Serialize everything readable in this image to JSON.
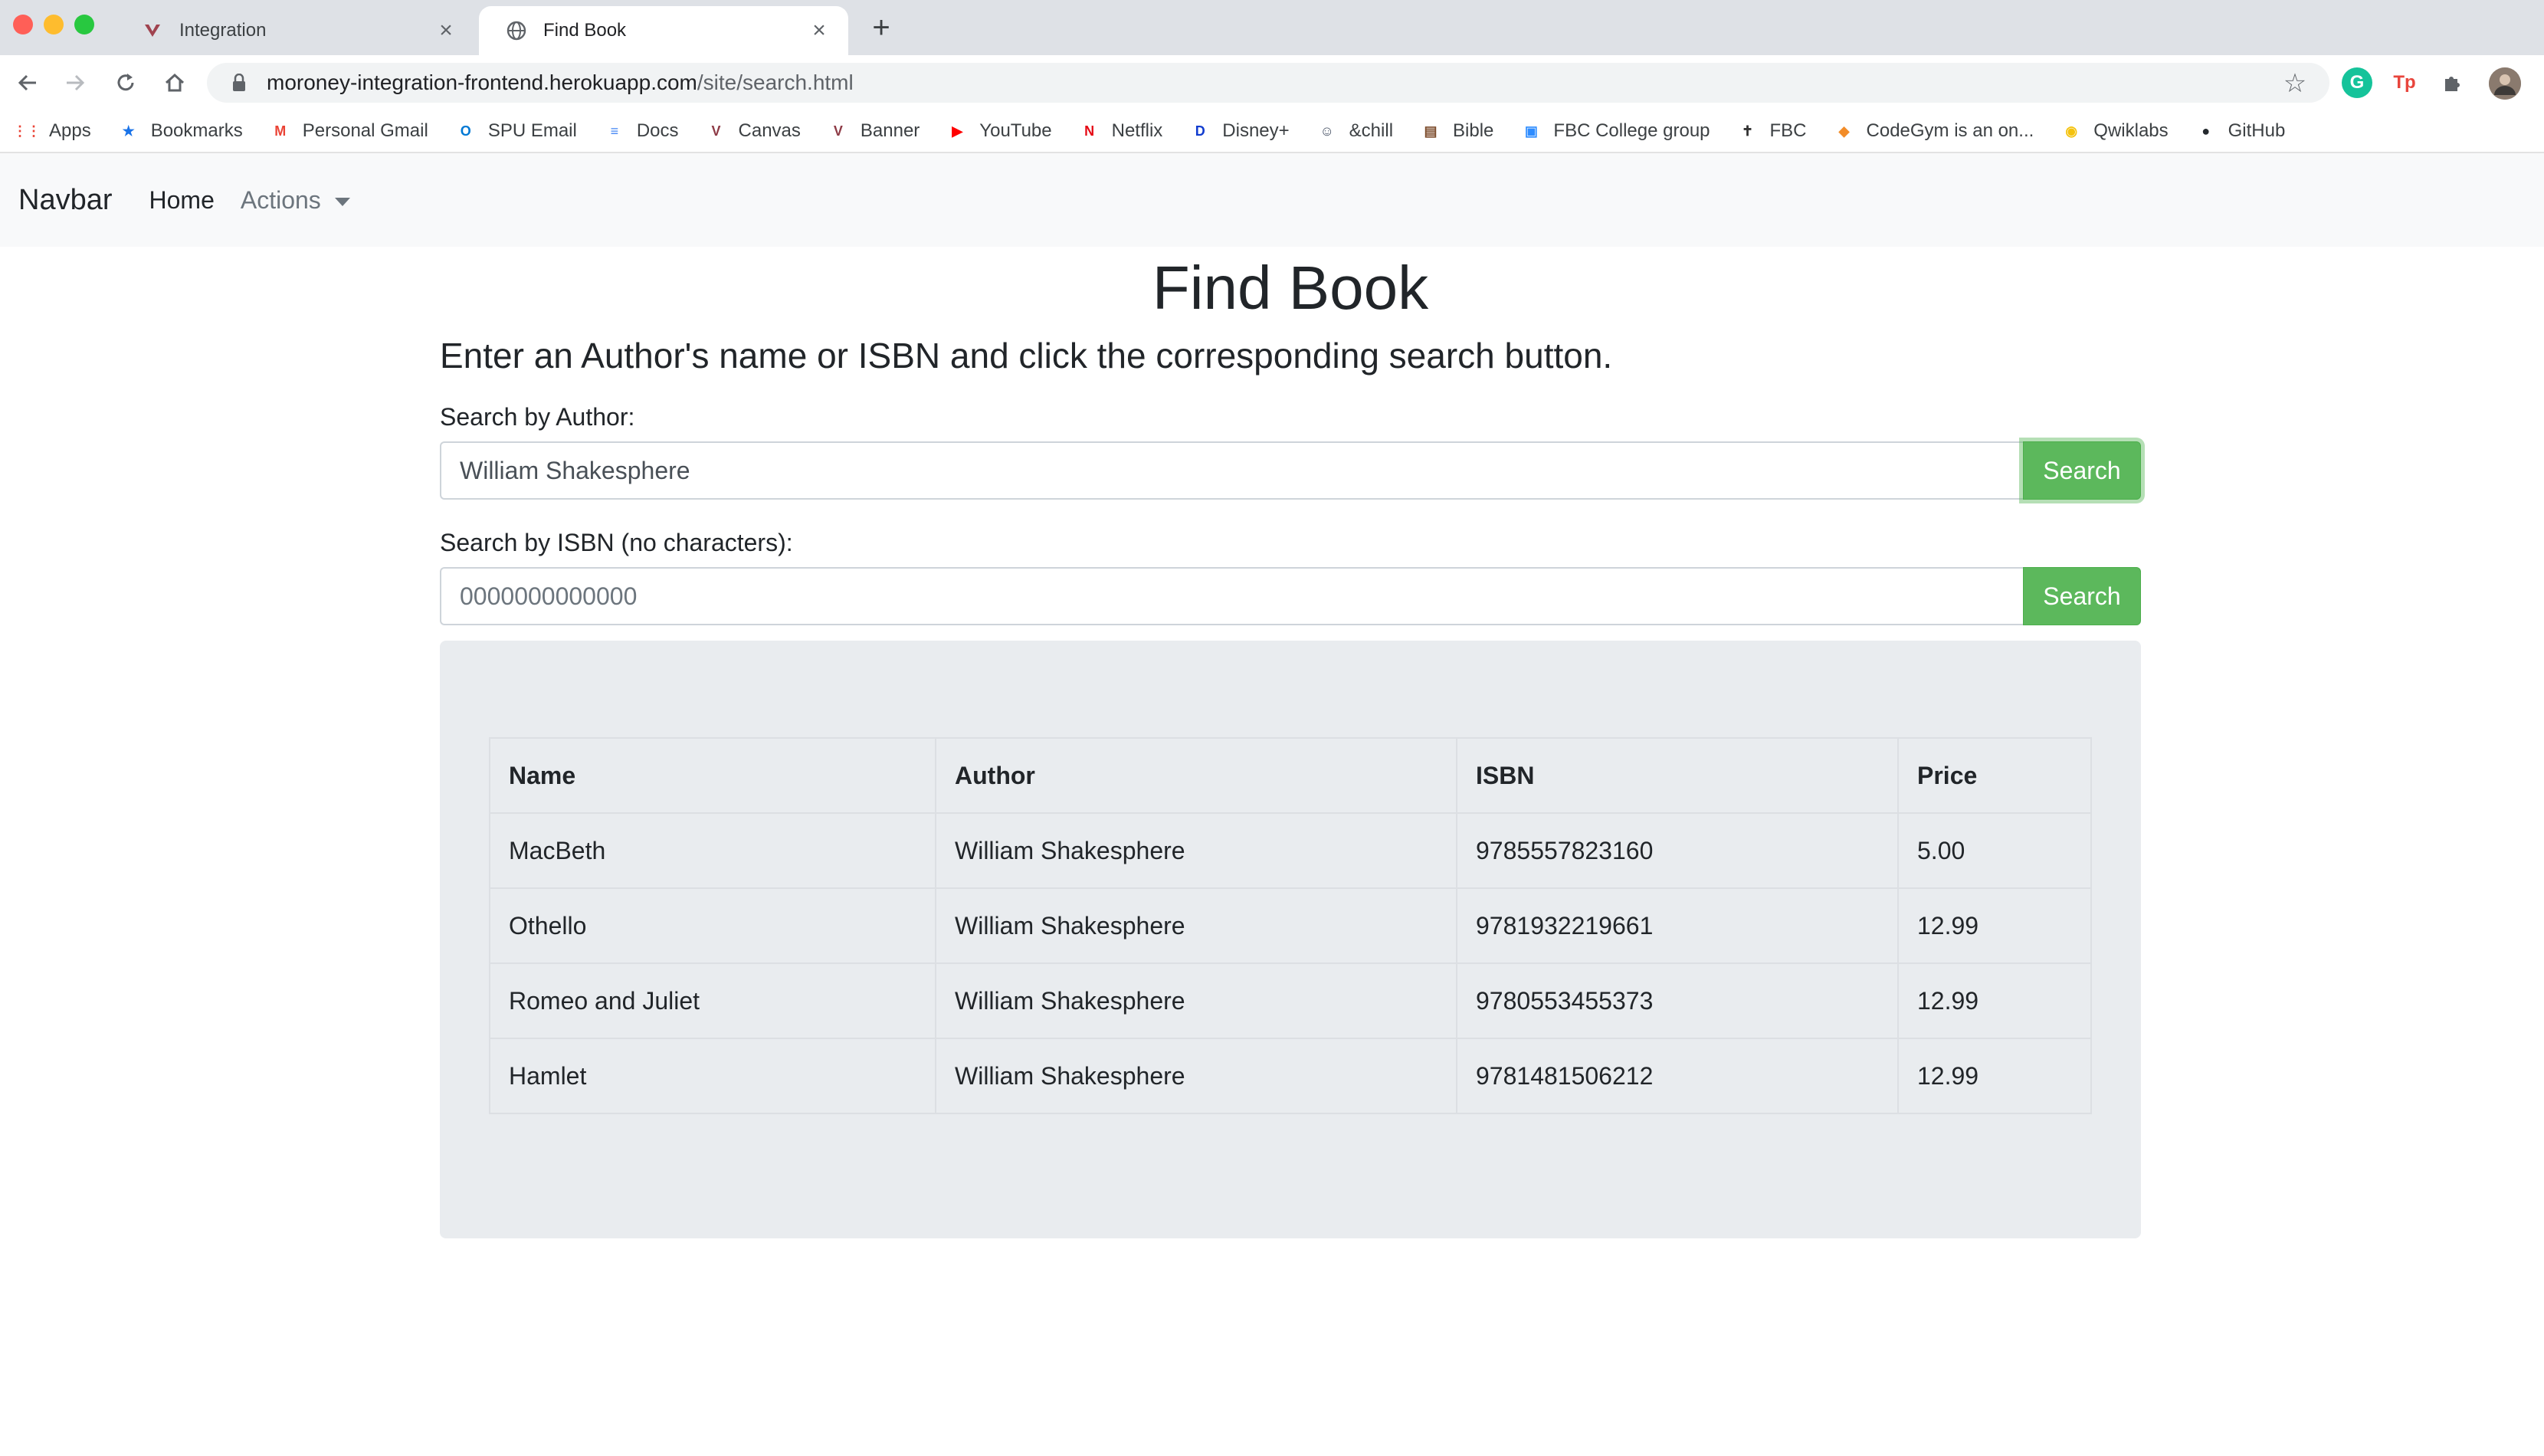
{
  "browser": {
    "tabs": [
      {
        "title": "Integration",
        "active": false,
        "icon": "canvas-logo-icon"
      },
      {
        "title": "Find Book",
        "active": true,
        "icon": "globe-icon"
      }
    ],
    "url_host": "moroney-integration-frontend.herokuapp.com",
    "url_path": "/site/search.html",
    "bookmarks": [
      {
        "label": "Apps",
        "icon": "apps-grid-icon",
        "color": "#ea4335"
      },
      {
        "label": "Bookmarks",
        "icon": "star-icon",
        "color": "#1a73e8"
      },
      {
        "label": "Personal Gmail",
        "icon": "gmail-icon",
        "color": "#ea4335"
      },
      {
        "label": "SPU Email",
        "icon": "outlook-icon",
        "color": "#0078d4"
      },
      {
        "label": "Docs",
        "icon": "docs-icon",
        "color": "#4285f4"
      },
      {
        "label": "Canvas",
        "icon": "canvas-icon",
        "color": "#8e3b46"
      },
      {
        "label": "Banner",
        "icon": "banner-icon",
        "color": "#8e3b46"
      },
      {
        "label": "YouTube",
        "icon": "youtube-icon",
        "color": "#ff0000"
      },
      {
        "label": "Netflix",
        "icon": "netflix-icon",
        "color": "#e50914"
      },
      {
        "label": "Disney+",
        "icon": "disney-icon",
        "color": "#113ccf"
      },
      {
        "label": "&chill",
        "icon": "chill-icon",
        "color": "#4a5568"
      },
      {
        "label": "Bible",
        "icon": "bible-icon",
        "color": "#7b4a2a"
      },
      {
        "label": "FBC College group",
        "icon": "zoom-icon",
        "color": "#2d8cff"
      },
      {
        "label": "FBC",
        "icon": "cross-icon",
        "color": "#333333"
      },
      {
        "label": "CodeGym is an on...",
        "icon": "codegym-icon",
        "color": "#f28c28"
      },
      {
        "label": "Qwiklabs",
        "icon": "qwiklabs-icon",
        "color": "#f4c20d"
      },
      {
        "label": "GitHub",
        "icon": "github-icon",
        "color": "#24292e"
      }
    ]
  },
  "navbar": {
    "brand": "Navbar",
    "home": "Home",
    "actions": "Actions"
  },
  "main": {
    "title": "Find Book",
    "subtitle": "Enter an Author's name or ISBN and click the corresponding search button.",
    "author_label": "Search by Author:",
    "author_value": "William Shakesphere",
    "isbn_label": "Search by ISBN (no characters):",
    "isbn_placeholder": "0000000000000",
    "search_button": "Search"
  },
  "results": {
    "headers": [
      "Name",
      "Author",
      "ISBN",
      "Price"
    ],
    "rows": [
      [
        "MacBeth",
        "William Shakesphere",
        "9785557823160",
        "5.00"
      ],
      [
        "Othello",
        "William Shakesphere",
        "9781932219661",
        "12.99"
      ],
      [
        "Romeo and Juliet",
        "William Shakesphere",
        "9780553455373",
        "12.99"
      ],
      [
        "Hamlet",
        "William Shakesphere",
        "9781481506212",
        "12.99"
      ]
    ]
  },
  "colors": {
    "success": "#5cb85c",
    "navbar_bg": "#f8f9fa",
    "jumbotron_bg": "#e9ecef"
  }
}
